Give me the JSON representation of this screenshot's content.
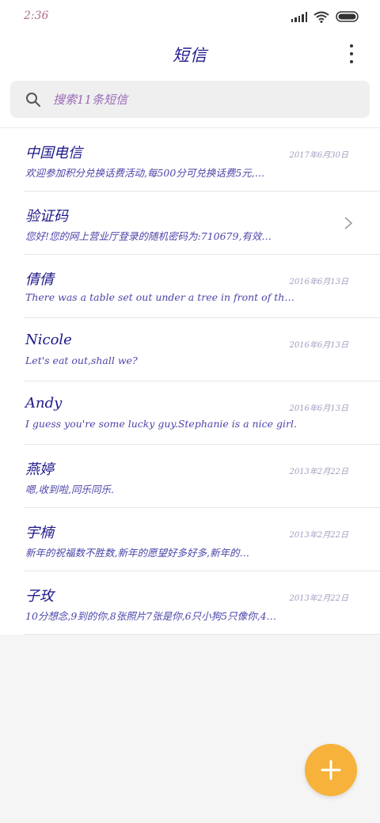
{
  "status_bar": {
    "time": "2:36",
    "icons": [
      "signal-icon",
      "wifi-icon",
      "battery-icon"
    ]
  },
  "header": {
    "title": "短信",
    "menu_icon": "more-vert-icon"
  },
  "search": {
    "placeholder": "搜索11条短信",
    "icon": "search-icon"
  },
  "conversations": [
    {
      "name": "中国电信",
      "date": "2017年6月30日",
      "preview": "欢迎参加积分兑换话费活动,每500分可兑换话费5元,…",
      "chevron": false
    },
    {
      "name": "验证码",
      "date": "",
      "preview": "您好!您的网上营业厅登录的随机密码为:710679,有效…",
      "chevron": true
    },
    {
      "name": "倩倩",
      "date": "2016年6月13日",
      "preview": "There was a table set out under a tree in front of th…",
      "chevron": false
    },
    {
      "name": "Nicole",
      "date": "2016年6月13日",
      "preview": "Let's eat out,shall we?",
      "chevron": false
    },
    {
      "name": "Andy",
      "date": "2016年6月13日",
      "preview": "I guess you're some lucky guy.Stephanie is a nice girl.",
      "chevron": false
    },
    {
      "name": "燕婷",
      "date": "2013年2月22日",
      "preview": "嗯,收到啦,同乐同乐.",
      "chevron": false
    },
    {
      "name": "宇楠",
      "date": "2013年2月22日",
      "preview": "新年的祝福数不胜数,新年的愿望好多好多,新年的…",
      "chevron": false
    },
    {
      "name": "子玫",
      "date": "2013年2月22日",
      "preview": "10分想念,9到的你,8张照片7张是你,6只小狗5只像你,4…",
      "chevron": false
    }
  ],
  "fab": {
    "icon": "plus-icon"
  },
  "colors": {
    "accent": "#f7b23b",
    "title": "#1e1a8a",
    "preview": "#4b44a8"
  }
}
